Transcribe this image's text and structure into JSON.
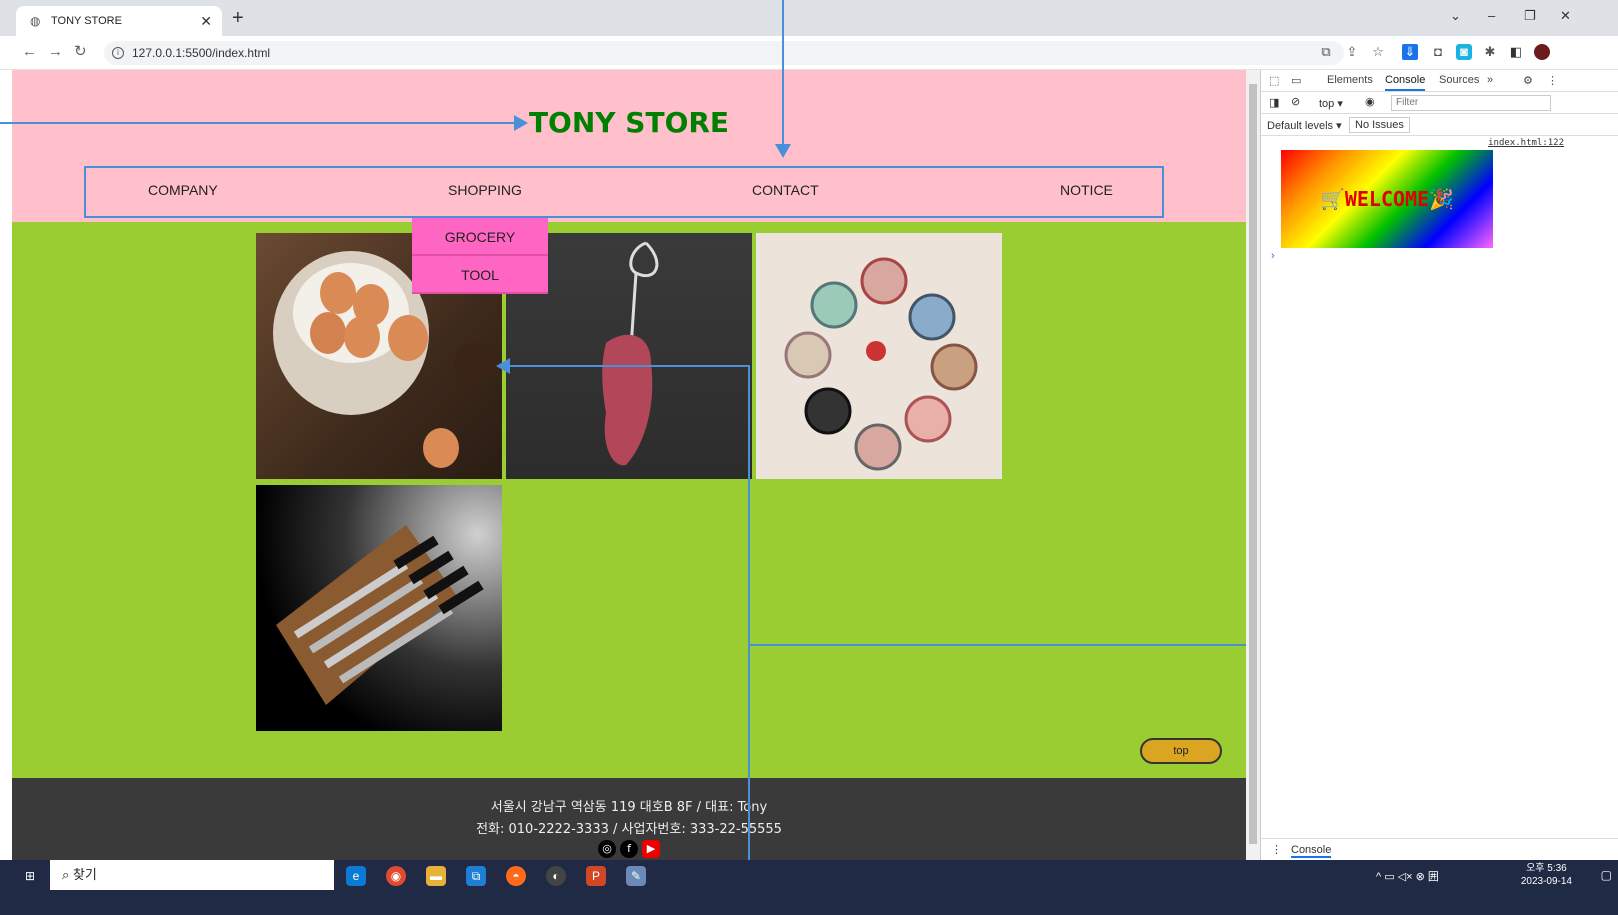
{
  "browser": {
    "tab_title": "TONY STORE",
    "url": "127.0.0.1:5500/index.html"
  },
  "site": {
    "title": "TONY STORE",
    "nav": [
      "COMPANY",
      "SHOPPING",
      "CONTACT",
      "NOTICE"
    ],
    "submenu": [
      "GROCERY",
      "TOOL"
    ],
    "gallery": [
      {
        "name": "eggs-photo",
        "icon": "egg-basket"
      },
      {
        "name": "meat-photo",
        "icon": "meat-hook"
      },
      {
        "name": "plates-photo",
        "icon": "decorative-plates"
      },
      {
        "name": "knives-photo",
        "icon": "knife-set"
      }
    ],
    "top_button": "top",
    "footer": {
      "address": "서울시 강남구 역삼동 119 대호B 8F / 대표: Tony",
      "phone": "전화: 010-2222-3333 / 사업자번호: 333-22-55555",
      "social": [
        "instagram-icon",
        "facebook-icon",
        "youtube-icon"
      ]
    }
  },
  "devtools": {
    "tabs": [
      "Elements",
      "Console",
      "Sources"
    ],
    "active_tab": "Console",
    "context": "top",
    "filter_placeholder": "Filter",
    "levels": "Default levels",
    "issues": "No Issues",
    "source_link": "index.html:122",
    "welcome_text": "WELCOME",
    "drawer_tab": "Console"
  },
  "taskbar": {
    "search_placeholder": "찾기",
    "time": "오후 5:36",
    "date": "2023-09-14"
  }
}
